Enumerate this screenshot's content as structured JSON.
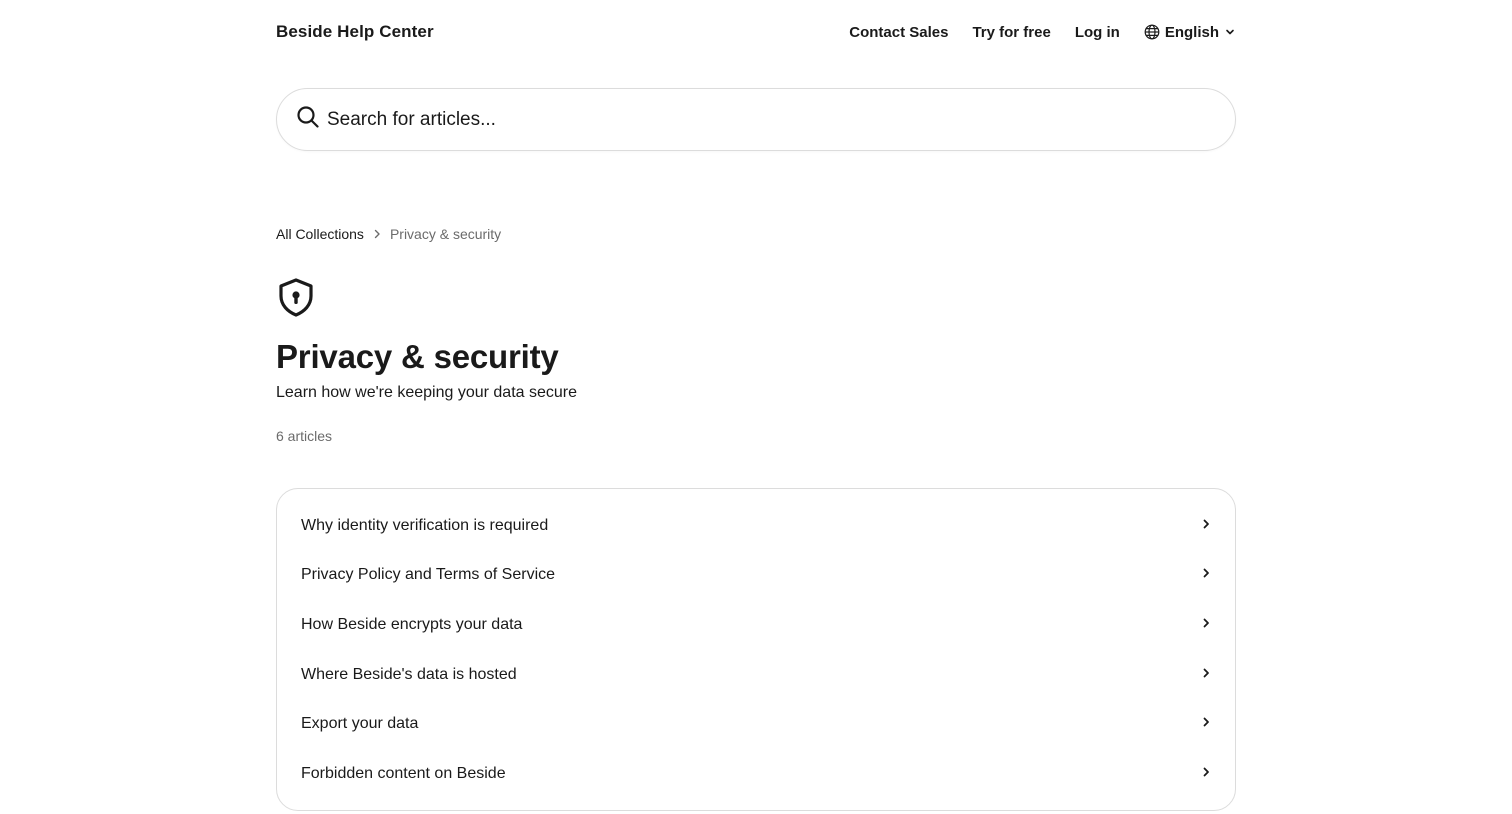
{
  "header": {
    "brand": "Beside Help Center",
    "nav": {
      "contact_sales": "Contact Sales",
      "try_free": "Try for free",
      "log_in": "Log in",
      "language": "English"
    }
  },
  "search": {
    "placeholder": "Search for articles..."
  },
  "breadcrumb": {
    "root": "All Collections",
    "current": "Privacy & security"
  },
  "collection": {
    "icon": "shield-lock-icon",
    "title": "Privacy & security",
    "description": "Learn how we're keeping your data secure",
    "article_count": "6 articles"
  },
  "articles": [
    {
      "title": "Why identity verification is required"
    },
    {
      "title": "Privacy Policy and Terms of Service"
    },
    {
      "title": "How Beside encrypts your data"
    },
    {
      "title": "Where Beside's data is hosted"
    },
    {
      "title": "Export your data"
    },
    {
      "title": "Forbidden content on Beside"
    }
  ],
  "colors": {
    "text": "#1a1a1a",
    "muted": "#6b6b6b",
    "border": "#dcdcdc",
    "background": "#ffffff"
  }
}
